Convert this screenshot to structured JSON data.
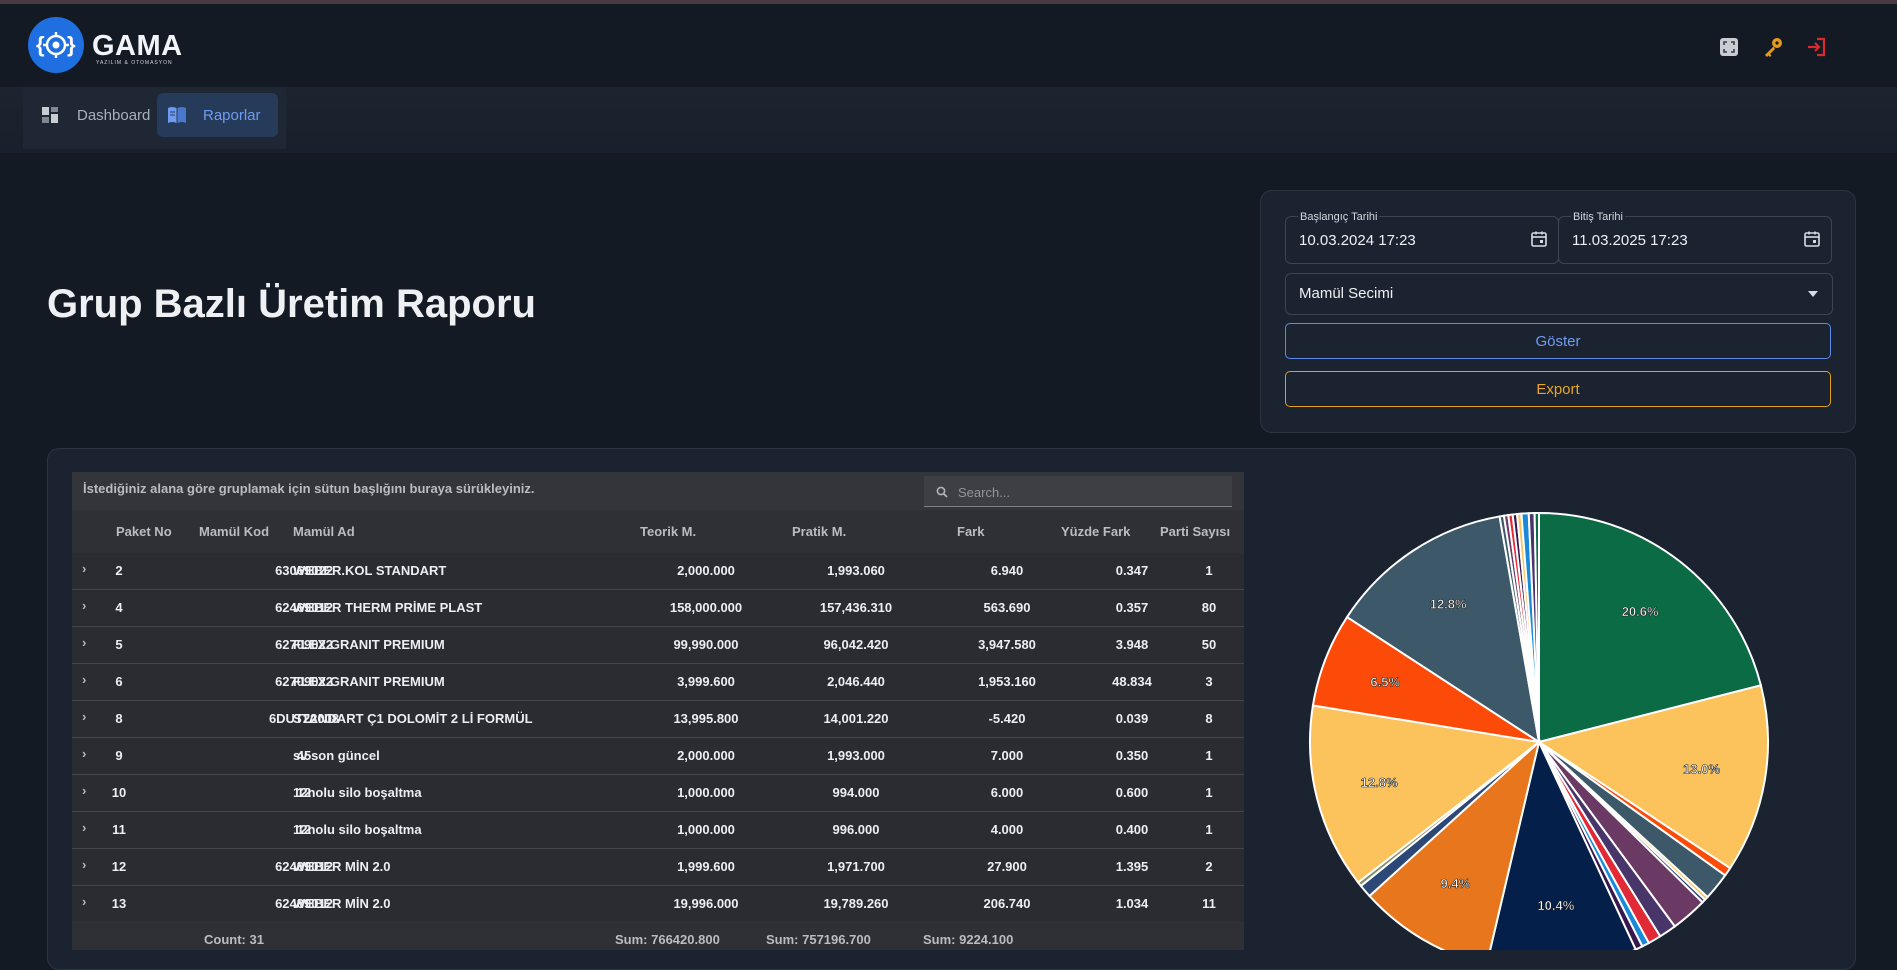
{
  "app": {
    "logo_title": "GAMA",
    "logo_subtitle": "YAZILIM & OTOMASYON",
    "header_icons": [
      "fullscreen-icon",
      "key-icon",
      "logout-icon"
    ]
  },
  "nav": {
    "items": [
      {
        "label": "Dashboard",
        "icon": "dashboard-icon",
        "active": false
      },
      {
        "label": "Raporlar",
        "icon": "book-icon",
        "active": true
      }
    ]
  },
  "page": {
    "title": "Grup Bazlı Üretim Raporu"
  },
  "filters": {
    "start_label": "Başlangıç Tarihi",
    "start_value": "10.03.2024 17:23",
    "end_label": "Bitiş Tarihi",
    "end_value": "11.03.2025 17:23",
    "product_select": "Mamül Secimi",
    "show_button": "Göster",
    "export_button": "Export"
  },
  "grid": {
    "group_panel_text": "İstediğiniz alana göre gruplamak için sütun başlığını buraya sürükleyiniz.",
    "search_placeholder": "Search...",
    "columns": [
      "Paket No",
      "Mamül Kod",
      "Mamül Ad",
      "Teorik M.",
      "Pratik M.",
      "Fark",
      "Yüzde Fark",
      "Parti Sayısı"
    ],
    "rows": [
      {
        "paket_no": "2",
        "kod": "63069022",
        "ad": "WEBER.KOL STANDART",
        "teorik": "2,000.000",
        "pratik": "1,993.060",
        "fark": "6.940",
        "yuzde": "0.347",
        "parti": "1"
      },
      {
        "paket_no": "4",
        "kod": "62469012",
        "ad": "WEBER THERM PRİME PLAST",
        "teorik": "158,000.000",
        "pratik": "157,436.310",
        "fark": "563.690",
        "yuzde": "0.357",
        "parti": "80"
      },
      {
        "paket_no": "5",
        "kod": "62709022",
        "ad": "FLEX GRANIT PREMIUM",
        "teorik": "99,990.000",
        "pratik": "96,042.420",
        "fark": "3,947.580",
        "yuzde": "3.948",
        "parti": "50"
      },
      {
        "paket_no": "6",
        "kod": "62709022",
        "ad": "FLEX GRANIT PREMIUM",
        "teorik": "3,999.600",
        "pratik": "2,046.440",
        "fark": "1,953.160",
        "yuzde": "48.834",
        "parti": "3"
      },
      {
        "paket_no": "8",
        "kod": "6DUT22008",
        "ad": "STANDART Ç1 DOLOMİT 2 Lİ FORMÜL",
        "teorik": "13,995.800",
        "pratik": "14,001.220",
        "fark": "-5.420",
        "yuzde": "0.039",
        "parti": "8"
      },
      {
        "paket_no": "9",
        "kod": "45",
        "ad": "sv son güncel",
        "teorik": "2,000.000",
        "pratik": "1,993.000",
        "fark": "7.000",
        "yuzde": "0.350",
        "parti": "1"
      },
      {
        "paket_no": "10",
        "kod": "12",
        "ad": "12nolu silo boşaltma",
        "teorik": "1,000.000",
        "pratik": "994.000",
        "fark": "6.000",
        "yuzde": "0.600",
        "parti": "1"
      },
      {
        "paket_no": "11",
        "kod": "12",
        "ad": "12nolu silo boşaltma",
        "teorik": "1,000.000",
        "pratik": "996.000",
        "fark": "4.000",
        "yuzde": "0.400",
        "parti": "1"
      },
      {
        "paket_no": "12",
        "kod": "62489012",
        "ad": "WEBER MİN 2.0",
        "teorik": "1,999.600",
        "pratik": "1,971.700",
        "fark": "27.900",
        "yuzde": "1.395",
        "parti": "2"
      },
      {
        "paket_no": "13",
        "kod": "62489012",
        "ad": "WEBER MİN 2.0",
        "teorik": "19,996.000",
        "pratik": "19,789.260",
        "fark": "206.740",
        "yuzde": "1.034",
        "parti": "11"
      }
    ],
    "footer": {
      "count": "Count: 31",
      "sum_teorik": "Sum: 766420.800",
      "sum_pratik": "Sum: 757196.700",
      "sum_fark": "Sum: 9224.100"
    }
  },
  "chart_data": {
    "type": "pie",
    "slices": [
      {
        "value": 20.6,
        "label": "20.6%",
        "color": "#0b6b45"
      },
      {
        "value": 13.0,
        "label": "13.0%",
        "color": "#fcc35c"
      },
      {
        "value": 0.6,
        "label": "",
        "color": "#fc4a09"
      },
      {
        "value": 1.9,
        "label": "",
        "color": "#3c5869"
      },
      {
        "value": 0.25,
        "label": "",
        "color": "#fcc35c"
      },
      {
        "value": 0.25,
        "label": "",
        "color": "#2c4876"
      },
      {
        "value": 2.5,
        "label": "",
        "color": "#6a3a64"
      },
      {
        "value": 1.2,
        "label": "",
        "color": "#48356a"
      },
      {
        "value": 0.9,
        "label": "",
        "color": "#e12a36"
      },
      {
        "value": 0.5,
        "label": "",
        "color": "#1a8ad8"
      },
      {
        "value": 0.5,
        "label": "",
        "color": "#36184e"
      },
      {
        "value": 10.4,
        "label": "10.4%",
        "color": "#031f4a"
      },
      {
        "value": 9.4,
        "label": "9.4%",
        "color": "#e8761c"
      },
      {
        "value": 0.9,
        "label": "",
        "color": "#2c4876"
      },
      {
        "value": 0.3,
        "label": "",
        "color": "#84906a"
      },
      {
        "value": 12.8,
        "label": "12.8%",
        "color": "#fcc35c"
      },
      {
        "value": 6.5,
        "label": "6.5%",
        "color": "#fc4a09"
      },
      {
        "value": 12.8,
        "label": "12.8%",
        "color": "#3c5869"
      },
      {
        "value": 0.3,
        "label": "",
        "color": "#3c5869"
      },
      {
        "value": 0.3,
        "label": "",
        "color": "#6a3a64"
      },
      {
        "value": 0.3,
        "label": "",
        "color": "#e12a36"
      },
      {
        "value": 0.3,
        "label": "",
        "color": "#36184e"
      },
      {
        "value": 0.3,
        "label": "",
        "color": "#fcc35c"
      },
      {
        "value": 0.5,
        "label": "",
        "color": "#1a8ad8"
      },
      {
        "value": 0.4,
        "label": "",
        "color": "#48356a"
      },
      {
        "value": 0.3,
        "label": "",
        "color": "#0b6b45"
      }
    ]
  }
}
